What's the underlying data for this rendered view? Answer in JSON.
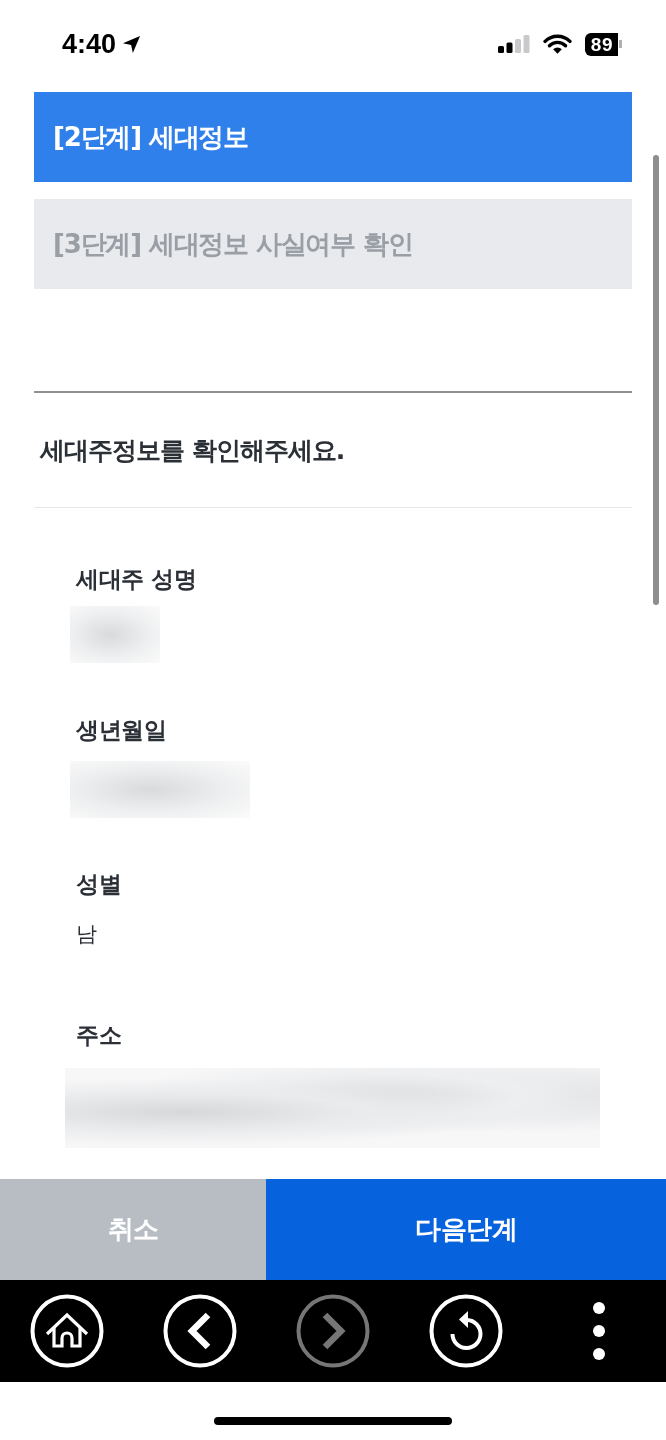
{
  "status_bar": {
    "time": "4:40",
    "battery": "89"
  },
  "steps": [
    {
      "label": "[2단계] 세대정보",
      "selected": true
    },
    {
      "label": "[3단계] 세대정보 사실여부 확인",
      "selected": false
    }
  ],
  "section": {
    "heading": "세대주정보를 확인해주세요.",
    "fields": [
      {
        "label": "세대주 성명",
        "blurred": true
      },
      {
        "label": "생년월일",
        "blurred": true
      },
      {
        "label": "성별",
        "value": "남",
        "blurred": false
      },
      {
        "label": "주소",
        "blurred": true
      }
    ]
  },
  "actions": [
    {
      "label": "취소",
      "kind": "cancel"
    },
    {
      "label": "다음단계",
      "kind": "primary"
    }
  ],
  "toolbar": [
    {
      "kind": "home",
      "disabled": false
    },
    {
      "kind": "back",
      "disabled": false
    },
    {
      "kind": "forward",
      "disabled": true
    },
    {
      "kind": "reload",
      "disabled": false
    },
    {
      "kind": "more",
      "disabled": false
    }
  ]
}
